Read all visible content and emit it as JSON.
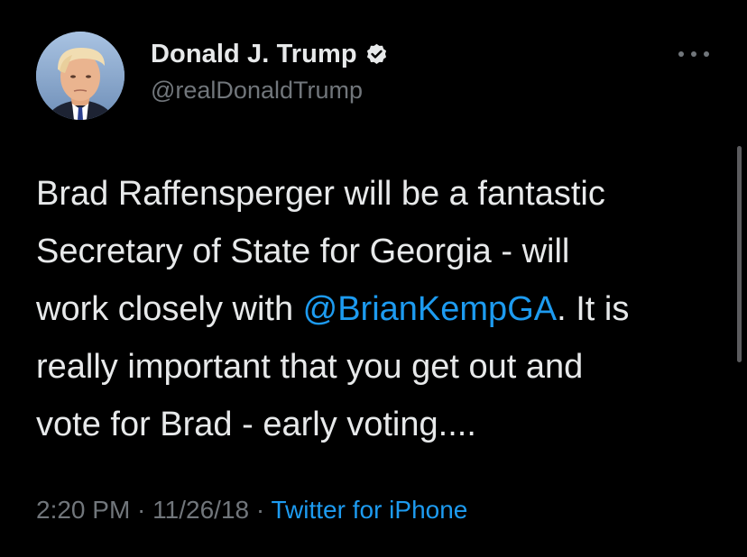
{
  "tweet": {
    "author": {
      "display_name": "Donald J. Trump",
      "handle": "@realDonaldTrump",
      "verified_icon": "verified-badge-icon"
    },
    "more_icon": "more-options-icon",
    "text": {
      "line1": "Brad Raffensperger will be a fantastic",
      "line2": "Secretary of State for Georgia - will",
      "line3_before": "work closely with ",
      "line3_mention": "@BrianKempGA",
      "line3_after": ". It is",
      "line4": "really important that you get out and",
      "line5": "vote for Brad - early voting...."
    },
    "meta": {
      "time": "2:20 PM",
      "separator1": " · ",
      "date": "11/26/18",
      "separator2": " · ",
      "source": "Twitter for iPhone"
    }
  },
  "colors": {
    "background": "#000000",
    "text_primary": "#e7e9ea",
    "text_secondary": "#71767b",
    "accent_blue": "#1d9bf0"
  }
}
